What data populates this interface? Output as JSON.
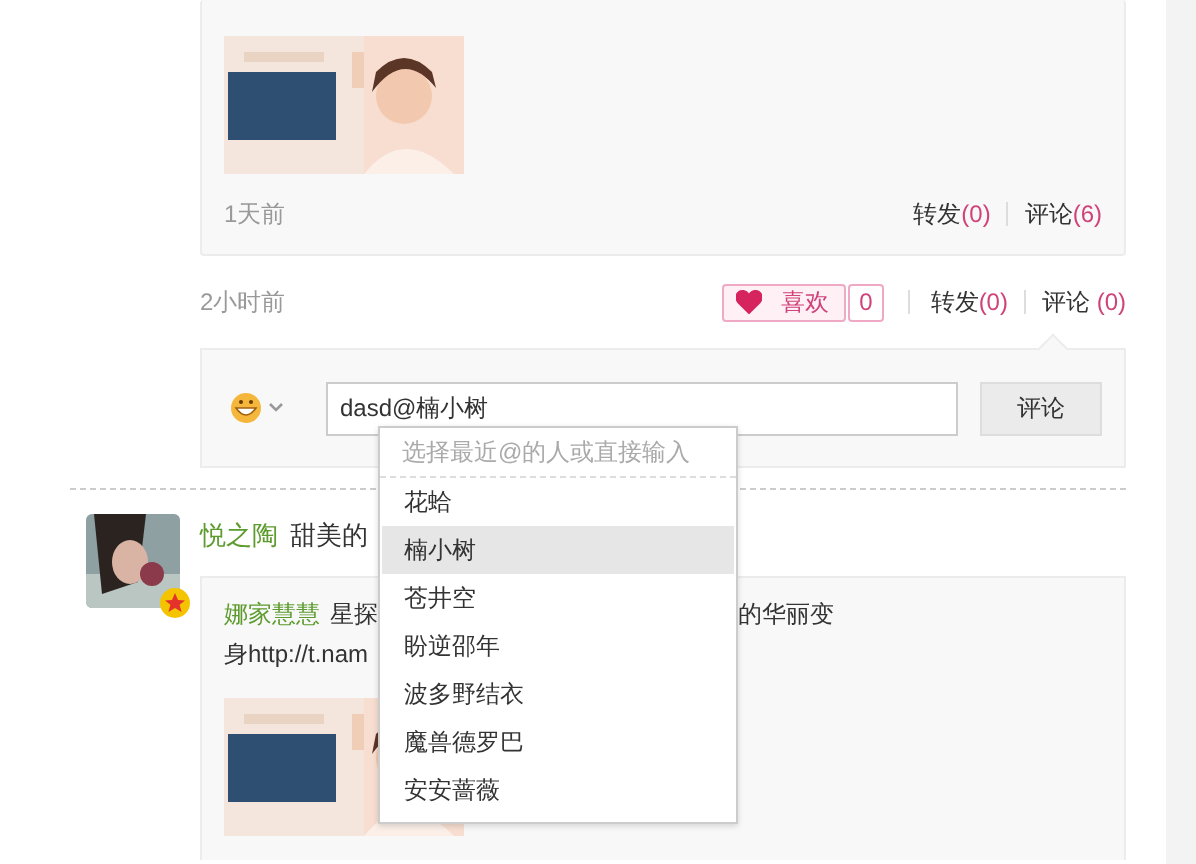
{
  "top_post": {
    "kind": "picture",
    "time": "1天前",
    "actions": [
      {
        "label": "转发",
        "count": "(0)"
      },
      {
        "label": "评论",
        "count": "(6)"
      }
    ]
  },
  "status_row": {
    "time": "2小时前",
    "like": {
      "label": "喜欢",
      "count": "0",
      "liked": true
    },
    "actions": [
      {
        "label": "转发",
        "count": "(0)"
      },
      {
        "label": "评论 ",
        "count": "(0)"
      }
    ]
  },
  "comment_box": {
    "value": "dasd@楠小树",
    "button": "评论",
    "mention_dropdown": {
      "hint": "选择最近@的人或直接输入",
      "items": [
        {
          "name": "花蛤",
          "selected": false
        },
        {
          "name": "楠小树",
          "selected": true
        },
        {
          "name": "苍井空",
          "selected": false
        },
        {
          "name": "盼逆邵年",
          "selected": false
        },
        {
          "name": "波多野结衣",
          "selected": false
        },
        {
          "name": "魔兽德罗巴",
          "selected": false
        },
        {
          "name": "安安蔷薇",
          "selected": false
        }
      ]
    }
  },
  "post": {
    "author": "悦之陶",
    "text": "甜美的",
    "verified": true,
    "repost": {
      "author": "娜家慧慧",
      "text_start": "星探",
      "text_end": "的华丽变",
      "line2": "身http://t.nam",
      "kind": "picture"
    }
  }
}
